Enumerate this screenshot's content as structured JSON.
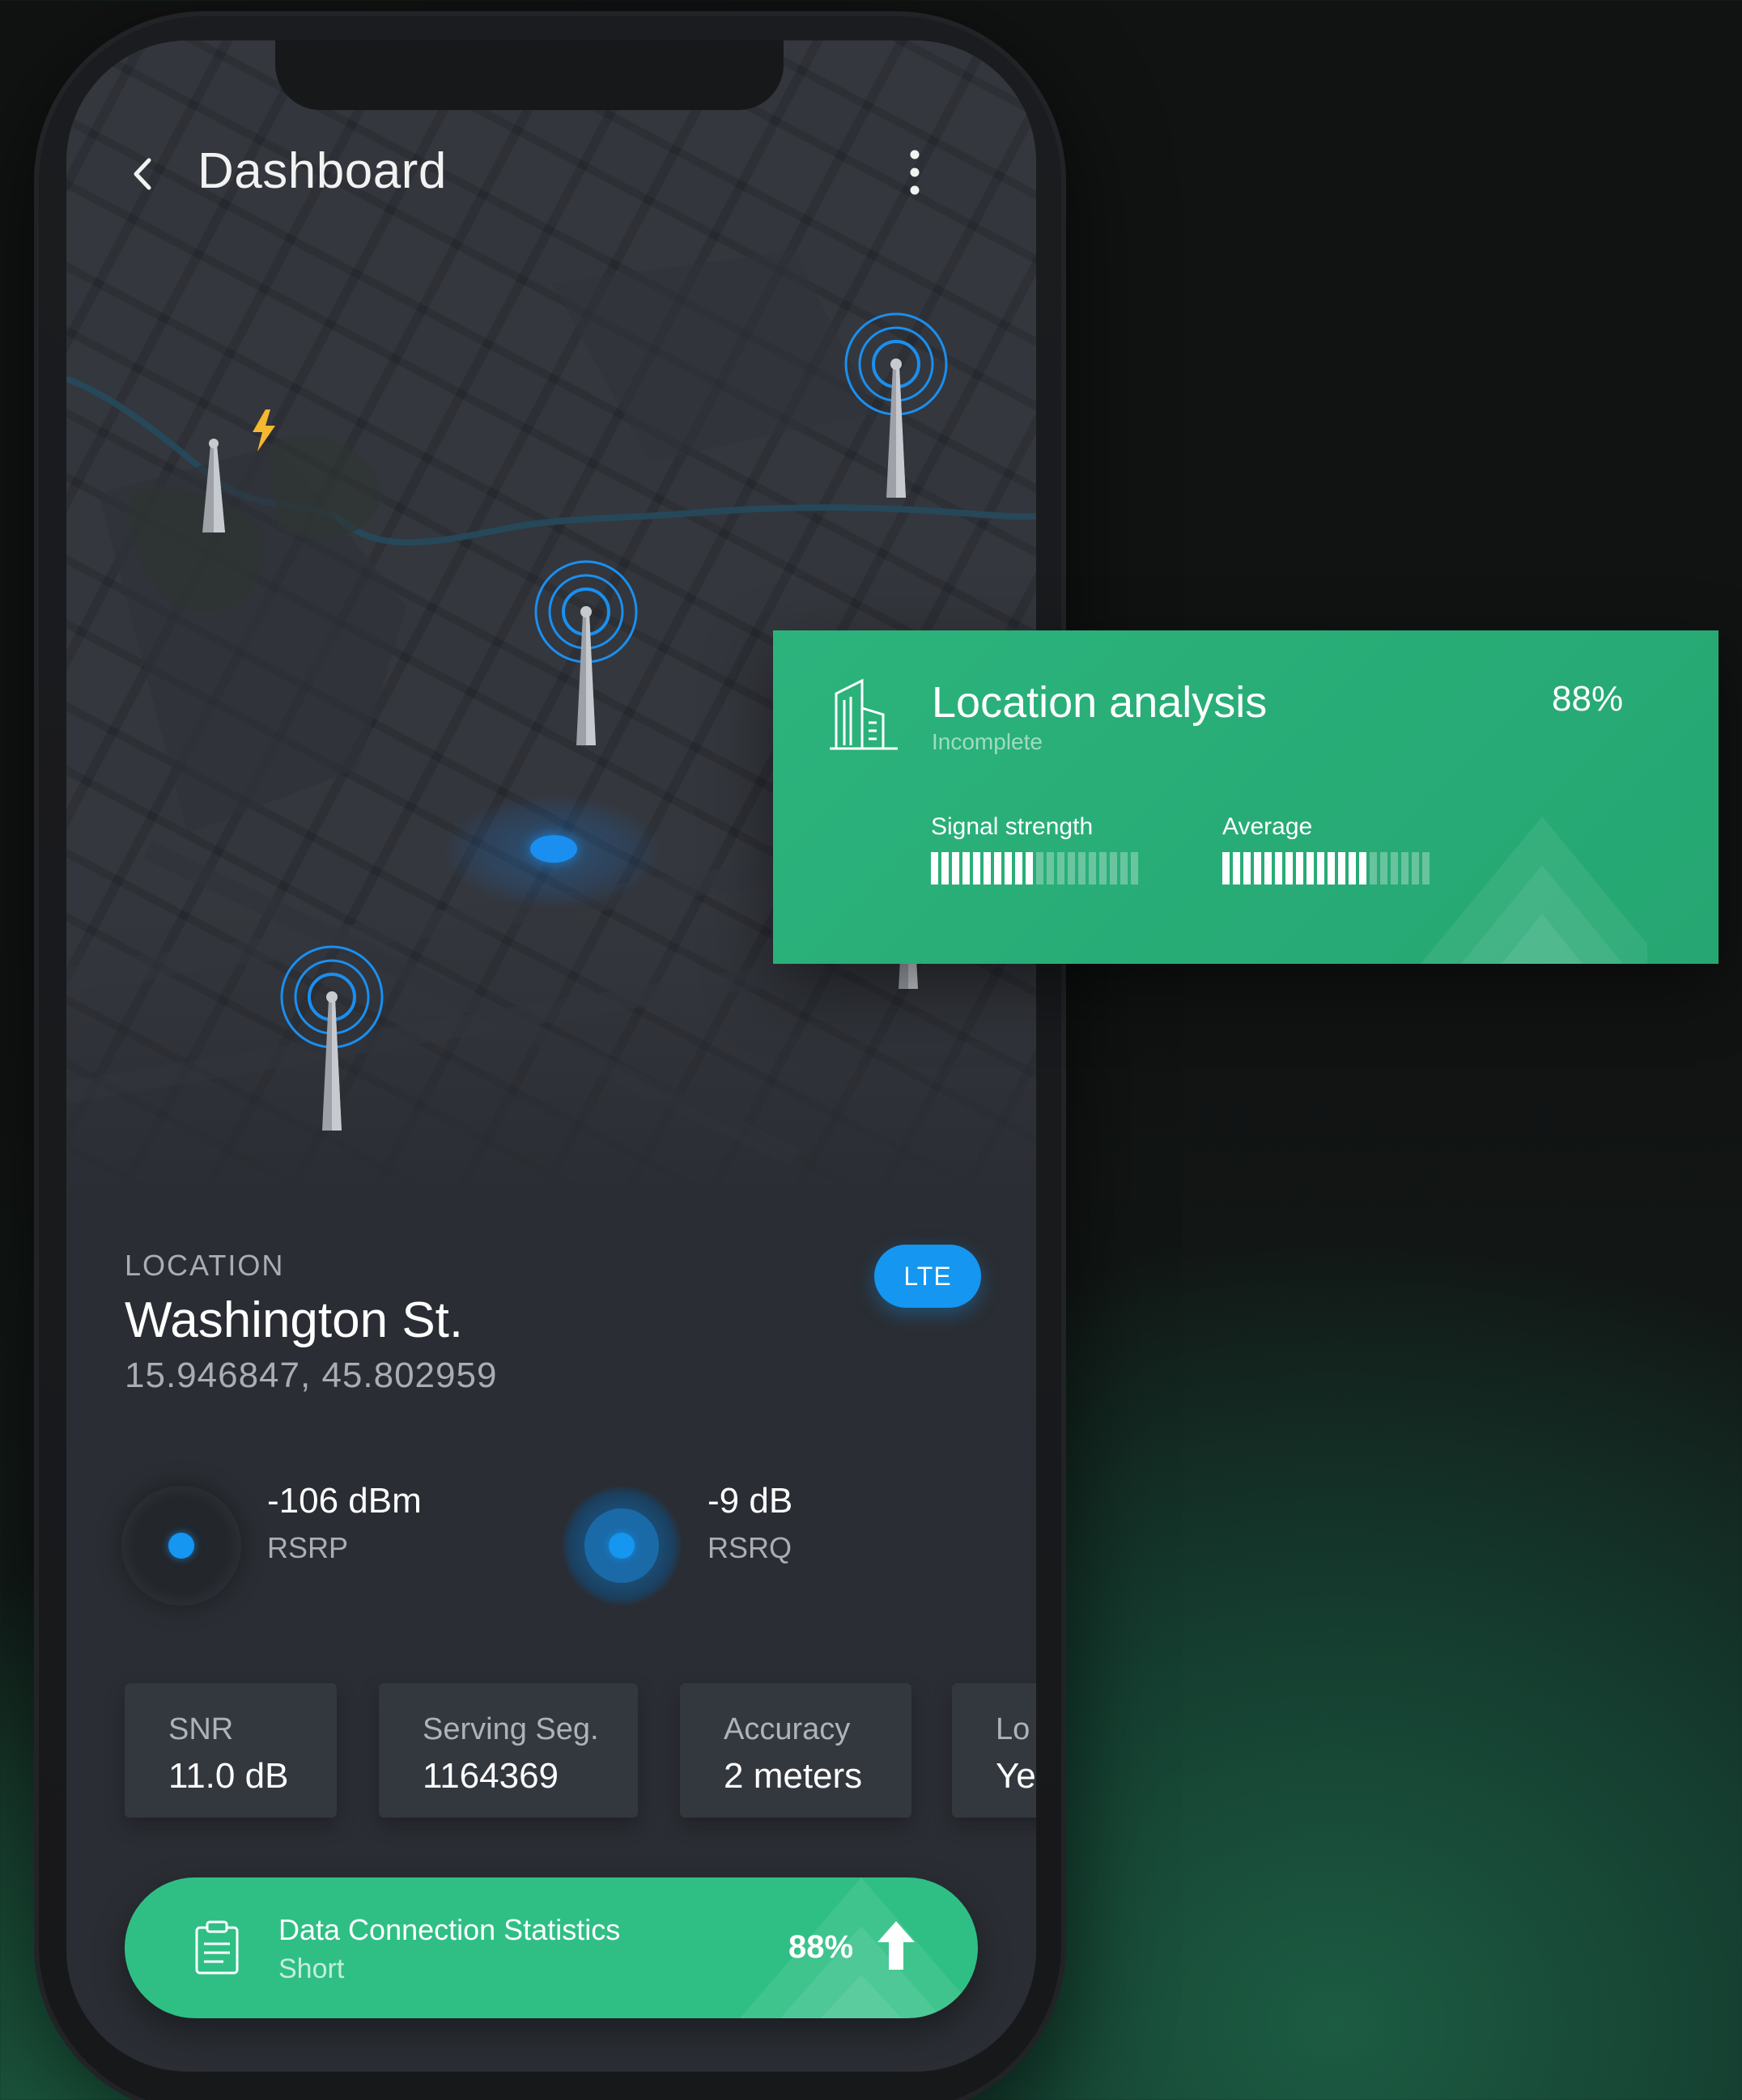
{
  "header": {
    "title": "Dashboard",
    "back_icon": "chevron-left-icon",
    "menu_icon": "more-vertical-icon"
  },
  "map": {
    "towers": [
      {
        "name": "tower-with-lightning",
        "ring": false,
        "lightning": true
      },
      {
        "name": "tower-top-right",
        "ring": true
      },
      {
        "name": "tower-center",
        "ring": true
      },
      {
        "name": "tower-bottom-left",
        "ring": true
      },
      {
        "name": "tower-partially-hidden",
        "ring": false
      }
    ]
  },
  "location": {
    "caption": "LOCATION",
    "name": "Washington St.",
    "coords": "15.946847, 45.802959",
    "network_badge": "LTE"
  },
  "metrics": [
    {
      "value": "-106 dBm",
      "label": "RSRP"
    },
    {
      "value": "-9 dB",
      "label": "RSRQ"
    }
  ],
  "stats": [
    {
      "label": "SNR",
      "value": "11.0 dB"
    },
    {
      "label": "Serving Seg.",
      "value": "1164369"
    },
    {
      "label": "Accuracy",
      "value": "2 meters"
    },
    {
      "label": "Lo",
      "value": "Ye"
    }
  ],
  "data_connection": {
    "title": "Data Connection Statistics",
    "subtitle": "Short",
    "percent": "88%",
    "icon": "clipboard-icon",
    "trend_icon": "arrow-up-icon"
  },
  "analysis": {
    "title": "Location analysis",
    "subtitle": "Incomplete",
    "percent": "88%",
    "icon": "building-icon",
    "signal_label": "Signal strength",
    "signal_level": 0.5,
    "average_label": "Average",
    "average_level": 0.7
  },
  "colors": {
    "accent_green": "#2fbf85",
    "accent_blue": "#1596f0",
    "lightning": "#f5b82e"
  }
}
